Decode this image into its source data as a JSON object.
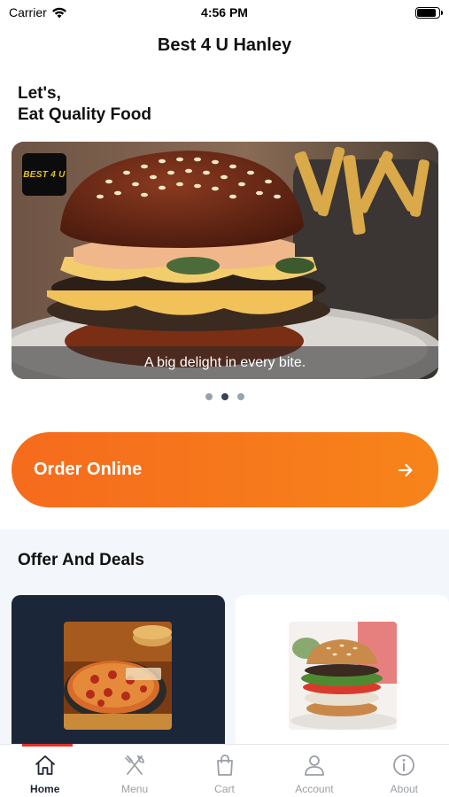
{
  "status_bar": {
    "carrier": "Carrier",
    "time": "4:56 PM",
    "battery_level": 0.9
  },
  "header": {
    "title": "Best 4 U Hanley"
  },
  "greeting": {
    "line1": "Let's,",
    "line2": "Eat Quality Food"
  },
  "carousel": {
    "brand_logo_text": "BEST 4 U",
    "caption": "A big delight in every bite.",
    "slide_count": 3,
    "active_index": 1
  },
  "order_button": {
    "label": "Order Online",
    "icon": "arrow-right-icon"
  },
  "offers": {
    "title": "Offer And Deals",
    "cards": [
      {
        "image": "pizza",
        "background": "#1c2639"
      },
      {
        "image": "burger",
        "background": "#ffffff"
      }
    ]
  },
  "tab_bar": {
    "active_index": 0,
    "tabs": [
      {
        "label": "Home",
        "icon": "home-icon"
      },
      {
        "label": "Menu",
        "icon": "fork-knife-icon"
      },
      {
        "label": "Cart",
        "icon": "shopping-bag-icon"
      },
      {
        "label": "Account",
        "icon": "user-icon"
      },
      {
        "label": "About",
        "icon": "info-icon"
      }
    ]
  },
  "colors": {
    "accent_orange": "#f66b1d",
    "active_tab_indicator": "#e0312b",
    "dark_card": "#1c2639"
  }
}
